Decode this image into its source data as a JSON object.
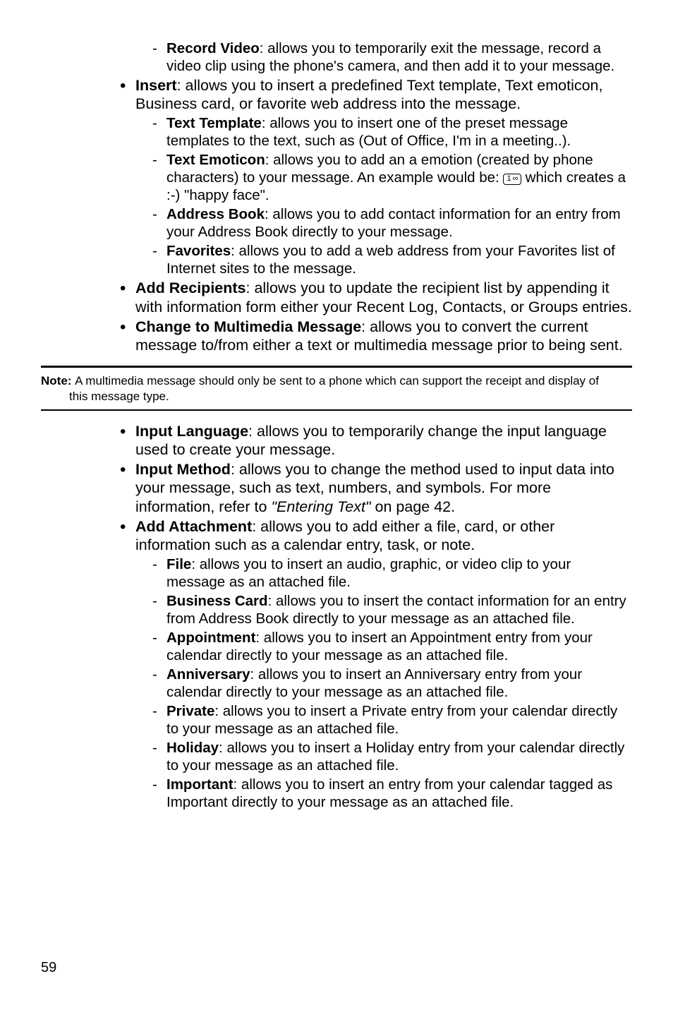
{
  "top_sub": {
    "record_video_label": "Record Video",
    "record_video_text": ": allows you to temporarily exit the message, record a video clip using the phone's camera, and then add it to your message."
  },
  "insert": {
    "label": "Insert",
    "text": ": allows you to insert a predefined Text template, Text emoticon, Business card, or favorite web address into the message.",
    "sub": {
      "text_template_label": "Text Template",
      "text_template_text": ": allows you to insert one of the preset message templates to the text, such as (Out of Office, I'm in a meeting..).",
      "text_emoticon_label": "Text Emoticon",
      "text_emoticon_text1": ": allows you to add an a emotion (created by phone characters) to your message. An example would be: ",
      "text_emoticon_key": "1 ∞",
      "text_emoticon_text2": " which creates a :-) \"happy face\".",
      "address_book_label": "Address Book",
      "address_book_text": ": allows you to add contact information for an entry from your Address Book directly to your message.",
      "favorites_label": "Favorites",
      "favorites_text": ": allows you to add a web address from your Favorites list of Internet sites to the message."
    }
  },
  "add_recipients": {
    "label": "Add Recipients",
    "text": ": allows you to update the recipient list by appending it with information form either your Recent Log, Contacts, or Groups entries."
  },
  "change_multimedia": {
    "label": "Change to Multimedia Message",
    "text": ": allows you to convert the current message to/from either a text or multimedia message prior to being sent."
  },
  "note": {
    "prefix": "Note: ",
    "line1": "A multimedia message should only be sent to a phone which can support the receipt and display of",
    "line2": "this message type."
  },
  "input_language": {
    "label": "Input Language",
    "text": ": allows you to temporarily change the input language used to create your message."
  },
  "input_method": {
    "label": "Input Method",
    "text1": ": allows you to change the method used to input data into your message, such as text, numbers, and symbols. For more information, refer to ",
    "italic": "\"Entering Text\" ",
    "text2": " on page 42."
  },
  "add_attachment": {
    "label": "Add Attachment",
    "text": ": allows you to add either a file, card, or other information such as a calendar entry, task, or note.",
    "sub": {
      "file_label": "File",
      "file_text": ": allows you to insert an audio, graphic, or video clip to your message as an attached file.",
      "business_card_label": "Business Card",
      "business_card_text": ": allows you to insert the contact information for an entry from Address Book directly to your message as an attached file.",
      "appointment_label": "Appointment",
      "appointment_text": ": allows you to insert an Appointment entry from your calendar directly to your message as an attached file.",
      "anniversary_label": "Anniversary",
      "anniversary_text": ": allows you to insert an Anniversary entry from your calendar directly to your message as an attached file.",
      "private_label": "Private",
      "private_text": ": allows you to insert a Private entry from your calendar directly to your message as an attached file.",
      "holiday_label": "Holiday",
      "holiday_text": ": allows you to insert a Holiday entry from your calendar directly to your message as an attached file.",
      "important_label": "Important",
      "important_text": ": allows you to insert an entry from your calendar tagged as Important directly to your message as an attached file."
    }
  },
  "page_number": "59"
}
